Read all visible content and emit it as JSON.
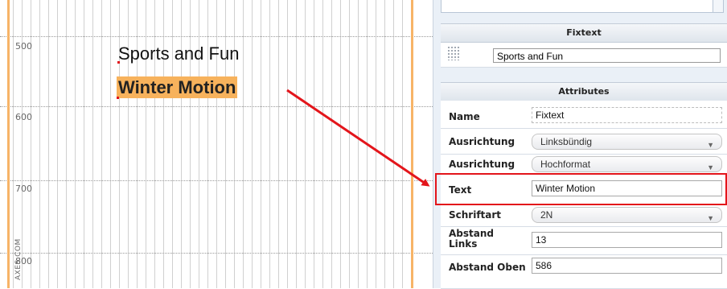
{
  "canvas": {
    "y_labels": [
      "500",
      "600",
      "700",
      "800"
    ],
    "text_sports": "Sports and Fun",
    "text_winter": "Winter Motion",
    "watermark": "AXES.COM"
  },
  "fixtext_section": {
    "title": "Fixtext",
    "value": "Sports and Fun"
  },
  "attributes_section": {
    "title": "Attributes",
    "fields": {
      "name": {
        "label": "Name",
        "value": "Fixtext"
      },
      "ausrichtung1": {
        "label": "Ausrichtung",
        "value": "Linksbündig"
      },
      "ausrichtung2": {
        "label": "Ausrichtung",
        "value": "Hochformat"
      },
      "text": {
        "label": "Text",
        "value": "Winter Motion"
      },
      "schriftart": {
        "label": "Schriftart",
        "value": "2N"
      },
      "abstand_links": {
        "label": "Abstand Links",
        "value": "13"
      },
      "abstand_oben": {
        "label": "Abstand Oben",
        "value": "586"
      }
    }
  },
  "colors": {
    "highlight_bg": "#f7b25c",
    "annotation_red": "#e3151b",
    "guide_orange": "#f7b467"
  }
}
